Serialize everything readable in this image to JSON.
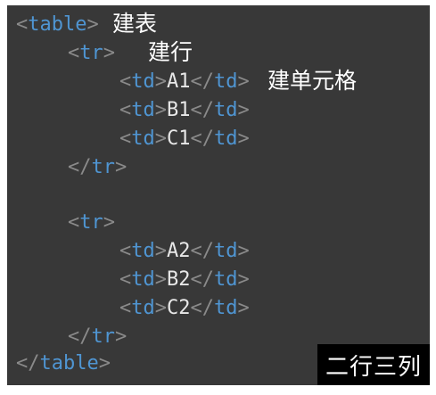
{
  "code": {
    "lt": "<",
    "gt": ">",
    "lt_slash": "</",
    "table": "table",
    "tr": "tr",
    "td": "td",
    "cells": [
      "A1",
      "B1",
      "C1",
      "A2",
      "B2",
      "C2"
    ]
  },
  "notes": {
    "table": "建表",
    "row": "建行",
    "cell": "建单元格"
  },
  "badge": "二行三列",
  "colors": {
    "background": "#383838",
    "bracket": "#8a8a8a",
    "tag": "#4f95d2",
    "text": "#e8e8e8",
    "note": "#ffffff",
    "badge_background": "#000000"
  }
}
